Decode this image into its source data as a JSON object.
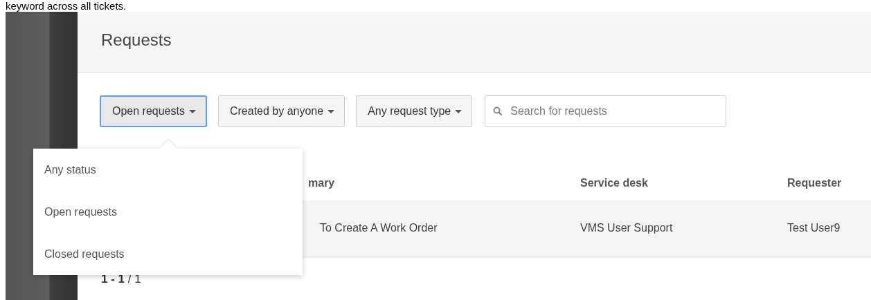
{
  "caption": "keyword across all tickets.",
  "header": {
    "title": "Requests"
  },
  "filters": [
    {
      "label": "Open requests",
      "selected": true
    },
    {
      "label": "Created by anyone",
      "selected": false
    },
    {
      "label": "Any request type",
      "selected": false
    }
  ],
  "search": {
    "placeholder": "Search for requests"
  },
  "status_menu": {
    "items": [
      {
        "label": "Any status",
        "selected": false
      },
      {
        "label": "Open requests",
        "selected": false
      },
      {
        "label": "Closed requests",
        "selected": false
      }
    ]
  },
  "table": {
    "columns": [
      "mary",
      "Service desk",
      "Requester"
    ],
    "rows": [
      [
        "To Create A Work Order",
        "VMS User Support",
        "Test User9"
      ]
    ]
  },
  "pagination": "**1 - 1** / 1"
}
